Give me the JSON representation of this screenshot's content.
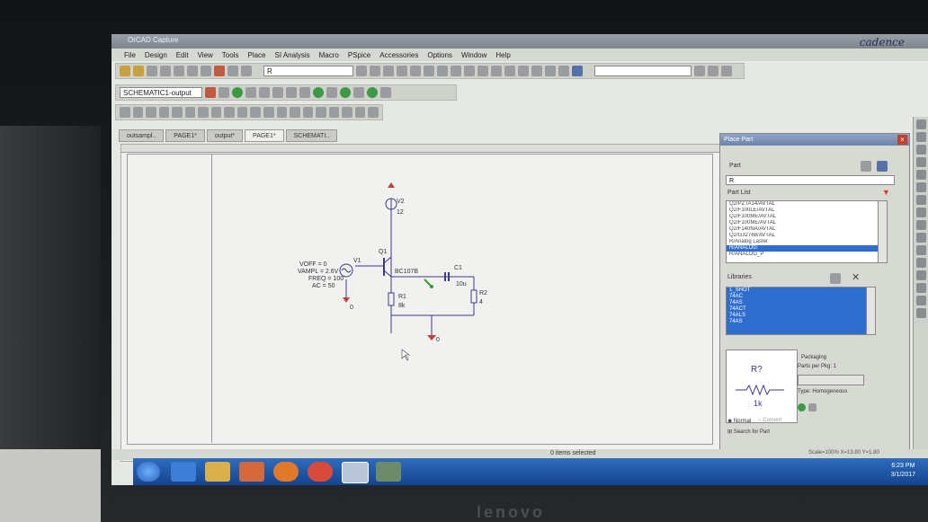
{
  "window": {
    "title": "OrCAD Capture",
    "brand": "cadence"
  },
  "menu": [
    "File",
    "Design",
    "Edit",
    "View",
    "Tools",
    "Place",
    "SI Analysis",
    "Macro",
    "PSpice",
    "Accessories",
    "Options",
    "Window",
    "Help"
  ],
  "toolbar": {
    "search_value": "R",
    "profile_select": "SCHEMATIC1-output"
  },
  "tabs": [
    "outsampl..",
    "PAGE1*",
    "output*",
    "PAGE1*",
    "SCHEMATI.."
  ],
  "schematic": {
    "v2_label": "V2",
    "v2_value": "12",
    "q1_label": "Q1",
    "q1_model": "BC107B",
    "v1_label": "V1",
    "v1_params": [
      "VOFF = 0",
      "VAMPL = 2.6V",
      "FREQ = 100",
      "AC = 50"
    ],
    "c1_label": "C1",
    "c1_value": "10u",
    "r1_label": "R1",
    "r1_value": "8k",
    "r2_label": "R2",
    "r2_value": "4",
    "gnd_label": "0"
  },
  "status": {
    "text": "0 items selected",
    "scale": "Scale=100%   X=13.80 Y=1.80"
  },
  "place_part": {
    "title": "Place Part",
    "part_label": "Part",
    "part_value": "R",
    "part_list_label": "Part List",
    "part_list": [
      "Q2/PZTA14/AVTAL",
      "Q2/F100LE/AVTAL",
      "Q2/F100ME/AVTAL",
      "Q2/F100ME/AVTAL",
      "Q2/F140NA/AVTAL",
      "Q2/G32768/AVTAL",
      "R/Analog Lasfer",
      "R/ANALOG",
      "R/ANALOG_P"
    ],
    "libraries_label": "Libraries",
    "libraries": [
      "1_SHOT",
      "74AC",
      "74AS",
      "74ACT",
      "74ALS",
      "74AS"
    ],
    "preview_ref": "R?",
    "preview_value": "1k",
    "packaging_label": "Packaging",
    "parts_per_pkg": "Parts per Pkg:   1",
    "type": "Type: Homogeneous",
    "normal_label": "Normal",
    "convert_label": "Convert",
    "search_label": "Search for Part"
  },
  "clock": {
    "time": "6:23 PM",
    "date": "3/1/2017"
  },
  "laptop_brand": "lenovo"
}
